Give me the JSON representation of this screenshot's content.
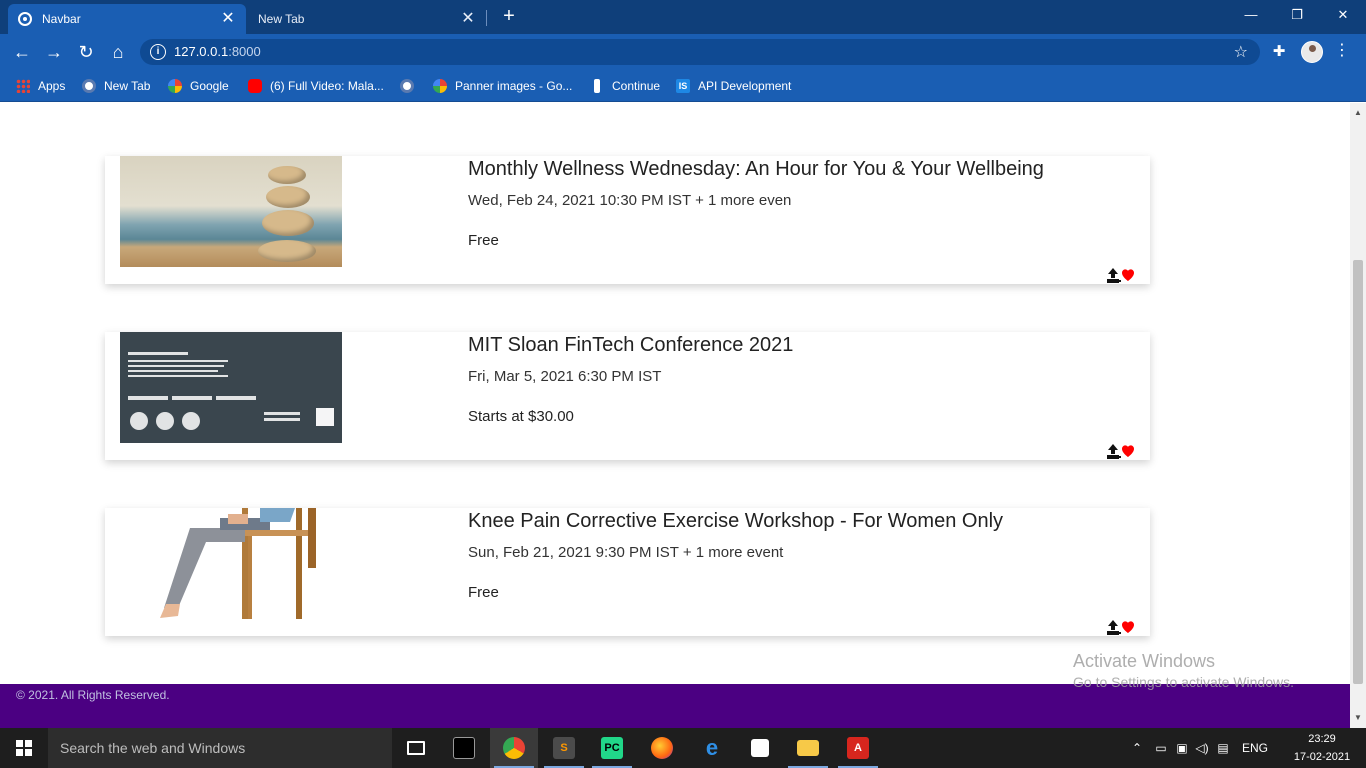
{
  "browser": {
    "tabs": [
      {
        "title": "Navbar",
        "active": true
      },
      {
        "title": "New Tab",
        "active": false
      }
    ],
    "new_tab_symbol": "+",
    "url_host": "127.0.0.1",
    "url_port": ":8000",
    "bookmarks": [
      {
        "label": "Apps",
        "icon": "apps-grid-icon"
      },
      {
        "label": "New Tab",
        "icon": "globe-icon"
      },
      {
        "label": "Google",
        "icon": "google-icon"
      },
      {
        "label": "(6) Full Video: Mala...",
        "icon": "youtube-icon"
      },
      {
        "label": "",
        "icon": "globe-icon"
      },
      {
        "label": "Panner images - Go...",
        "icon": "google-icon"
      },
      {
        "label": "Continue",
        "icon": "tool-icon"
      },
      {
        "label": "API Development",
        "icon": "is-icon"
      }
    ]
  },
  "events": [
    {
      "title": "Monthly Wellness Wednesday: An Hour for You & Your Wellbeing",
      "date": "Wed, Feb 24, 2021 10:30 PM IST + 1 more even",
      "price": "Free",
      "image": "stacked-stones-image"
    },
    {
      "title": "MIT Sloan FinTech Conference 2021",
      "date": "Fri, Mar 5, 2021 6:30 PM IST",
      "price": "Starts at $30.00",
      "image": "fintech-conference-image"
    },
    {
      "title": "Knee Pain Corrective Exercise Workshop - For Women Only",
      "date": "Sun, Feb 21, 2021 9:30 PM IST + 1 more event",
      "price": "Free",
      "image": "woman-on-chair-image"
    }
  ],
  "footer": {
    "copyright": "© 2021. All Rights Reserved."
  },
  "watermark": {
    "line1": "Activate Windows",
    "line2": "Go to Settings to activate Windows."
  },
  "taskbar": {
    "search_placeholder": "Search the web and Windows",
    "language": "ENG",
    "time": "23:29",
    "date": "17-02-2021"
  },
  "colors": {
    "tab_strip": "#0f3f7a",
    "toolbar": "#1a5eb3",
    "footer": "#4b0082",
    "heart": "#ff0000"
  }
}
